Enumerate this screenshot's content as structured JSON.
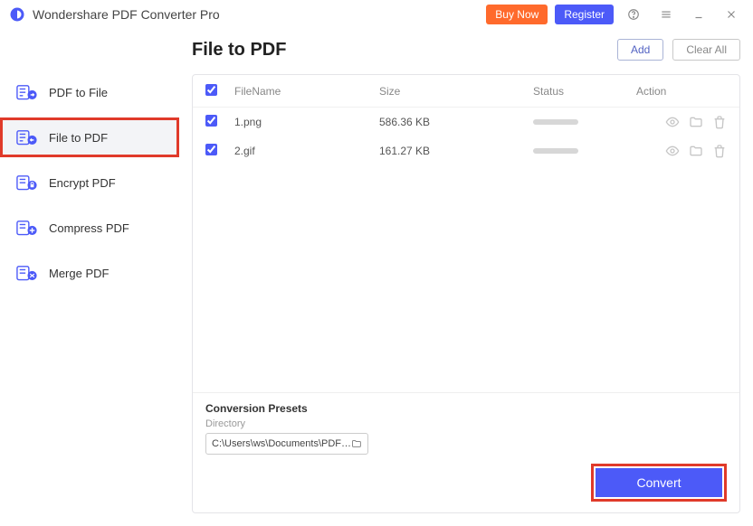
{
  "app": {
    "title": "Wondershare PDF Converter Pro"
  },
  "titlebar": {
    "buy": "Buy Now",
    "register": "Register"
  },
  "sidebar": {
    "items": [
      {
        "label": "PDF to File"
      },
      {
        "label": "File to PDF"
      },
      {
        "label": "Encrypt PDF"
      },
      {
        "label": "Compress PDF"
      },
      {
        "label": "Merge PDF"
      }
    ],
    "active_index": 1
  },
  "page": {
    "title": "File to PDF"
  },
  "actions": {
    "add": "Add",
    "clear_all": "Clear All"
  },
  "table": {
    "headers": {
      "filename": "FileName",
      "size": "Size",
      "status": "Status",
      "action": "Action"
    },
    "rows": [
      {
        "name": "1.png",
        "size": "586.36 KB"
      },
      {
        "name": "2.gif",
        "size": "161.27 KB"
      }
    ]
  },
  "presets": {
    "title": "Conversion Presets",
    "directory_label": "Directory",
    "directory_value": "C:\\Users\\ws\\Documents\\PDFConvert"
  },
  "convert": {
    "label": "Convert"
  }
}
